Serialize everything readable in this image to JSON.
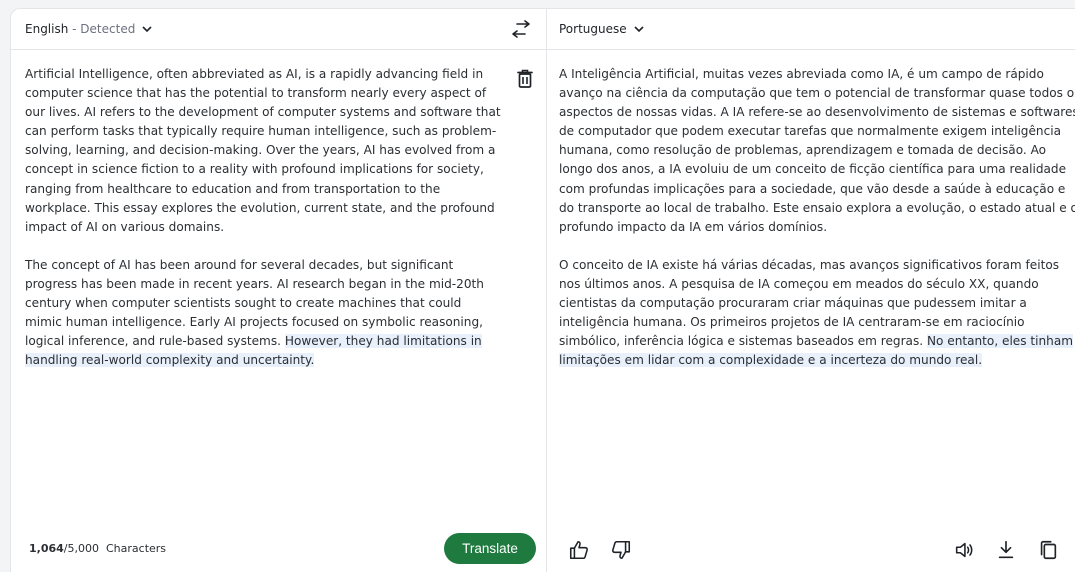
{
  "source": {
    "language": "English",
    "detected_label": " - Detected",
    "paragraph_1": "Artificial Intelligence, often abbreviated as AI, is a rapidly advancing field in computer science that has the potential to transform nearly every aspect of our lives. AI refers to the development of computer systems and software that can perform tasks that typically require human intelligence, such as problem-solving, learning, and decision-making. Over the years, AI has evolved from a concept in science fiction to a reality with profound implications for society, ranging from healthcare to education and from transportation to the workplace. This essay explores the evolution, current state, and the profound impact of AI on various domains.",
    "paragraph_2_plain": "The concept of AI has been around for several decades, but significant progress has been made in recent years. AI research began in the mid-20th century when computer scientists sought to create machines that could mimic human intelligence. Early AI projects focused on symbolic reasoning, logical inference, and rule-based systems. ",
    "paragraph_2_highlight": "However, they had limitations in handling real-world complexity and uncertainty.",
    "char_count": "1,064",
    "char_limit": "/5,000",
    "char_label": "Characters",
    "translate_label": "Translate"
  },
  "target": {
    "language": "Portuguese",
    "paragraph_1": "A Inteligência Artificial, muitas vezes abreviada como IA, é um campo de rápido avanço na ciência da computação que tem o potencial de transformar quase todos os aspectos de nossas vidas. A IA refere-se ao desenvolvimento de sistemas e softwares de computador que podem executar tarefas que normalmente exigem inteligência humana, como resolução de problemas, aprendizagem e tomada de decisão. Ao longo dos anos, a IA evoluiu de um conceito de ficção científica para uma realidade com profundas implicações para a sociedade, que vão desde a saúde à educação e do transporte ao local de trabalho. Este ensaio explora a evolução, o estado atual e o profundo impacto da IA em vários domínios.",
    "paragraph_2_plain": "O conceito de IA existe há várias décadas, mas avanços significativos foram feitos nos últimos anos. A pesquisa de IA começou em meados do século XX, quando cientistas da computação procuraram criar máquinas que pudessem imitar a inteligência humana. Os primeiros projetos de IA centraram-se em raciocínio simbólico, inferência lógica e sistemas baseados em regras. ",
    "paragraph_2_highlight": "No entanto, eles tinham limitações em lidar com a complexidade e a incerteza do mundo real."
  },
  "icons": {
    "source_chevron": "chevron-down-icon",
    "target_chevron": "chevron-down-icon",
    "swap": "swap-arrows-icon",
    "clear": "trash-icon",
    "like": "thumbs-up-icon",
    "dislike": "thumbs-down-icon",
    "listen": "speaker-icon",
    "download": "download-icon",
    "copy": "copy-icon"
  },
  "colors": {
    "accent": "#1e7a3e",
    "highlight": "#e8f0fb"
  }
}
